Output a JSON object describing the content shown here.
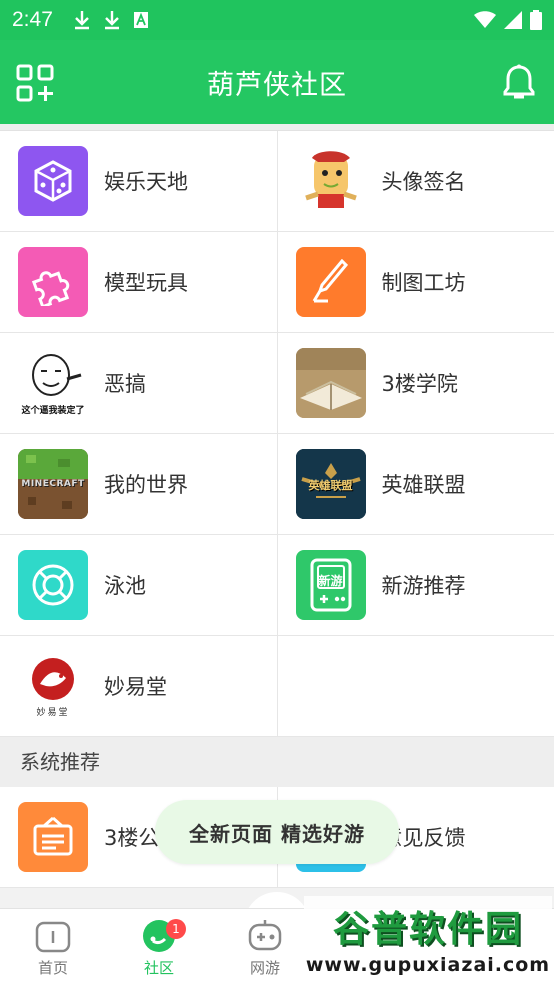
{
  "status_bar": {
    "time": "2:47"
  },
  "header": {
    "title": "葫芦侠社区"
  },
  "categories": [
    {
      "label": "娱乐天地",
      "icon": "dice-icon",
      "color": "#8e56f0"
    },
    {
      "label": "头像签名",
      "icon": "cartoon-avatar-icon",
      "color": "#ffffff"
    },
    {
      "label": "模型玩具",
      "icon": "puzzle-icon",
      "color": "#f45bb5"
    },
    {
      "label": "制图工坊",
      "icon": "pen-nib-icon",
      "color": "#ff7b2c"
    },
    {
      "label": "恶搞",
      "icon": "meme-face-icon",
      "color": "#ffffff",
      "caption": "这个逼我装定了"
    },
    {
      "label": "3楼学院",
      "icon": "open-book-icon",
      "color": "#c9b48e"
    },
    {
      "label": "我的世界",
      "icon": "minecraft-icon",
      "color": "#5aa83a",
      "caption": "MINECRAFT"
    },
    {
      "label": "英雄联盟",
      "icon": "lol-icon",
      "color": "#0f2c3c",
      "caption": "英雄联盟"
    },
    {
      "label": "泳池",
      "icon": "lifebuoy-icon",
      "color": "#2fd9c9"
    },
    {
      "label": "新游推荐",
      "icon": "gamepad-new-icon",
      "color": "#2fc86a",
      "caption": "新游"
    },
    {
      "label": "妙易堂",
      "icon": "fish-logo-icon",
      "color": "#ffffff",
      "caption": "妙易堂"
    }
  ],
  "system_section": {
    "title": "系统推荐",
    "items": [
      {
        "label": "3楼公",
        "icon": "notice-board-icon",
        "color": "#ff8a3a"
      },
      {
        "label": "意见反馈",
        "icon": "feedback-icon",
        "color": "#2cc0e8"
      }
    ]
  },
  "toast": {
    "text": "全新页面  精选好游"
  },
  "bottom_nav": {
    "tabs": [
      {
        "label": "首页",
        "icon": "home-icon"
      },
      {
        "label": "社区",
        "icon": "community-icon",
        "badge": "1"
      },
      {
        "label": "网游",
        "icon": "gamepad-icon"
      }
    ]
  },
  "watermark": {
    "title": "谷普软件园",
    "url": "www.gupuxiazai.com"
  },
  "colors": {
    "accent": "#24c762",
    "badge": "#ff4a4a"
  }
}
